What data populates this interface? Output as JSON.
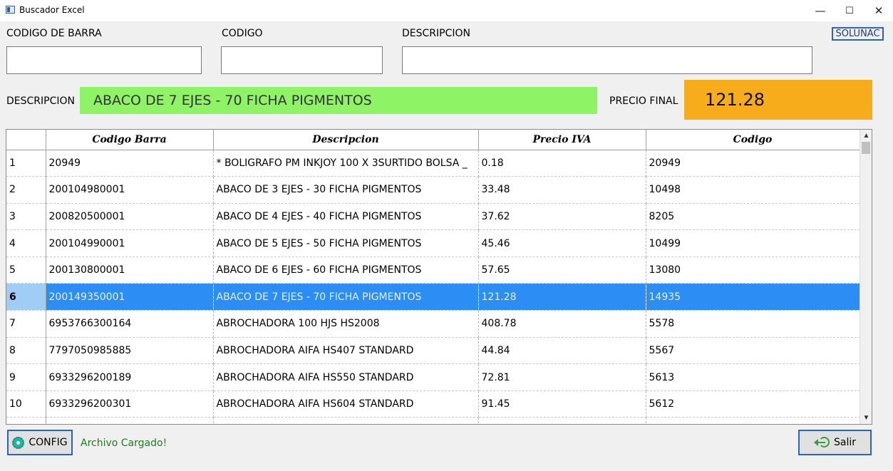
{
  "window": {
    "title": "Buscador Excel",
    "minimize": "—",
    "maximize": "☐",
    "close": "✕"
  },
  "search": {
    "barcode_label": "CODIGO DE BARRA",
    "code_label": "CODIGO",
    "description_label": "DESCRIPCION",
    "barcode_value": "",
    "code_value": "",
    "description_value": ""
  },
  "brand": "SOLUNAC",
  "result": {
    "description_label": "DESCRIPCION",
    "description_value": "ABACO DE 7 EJES - 70 FICHA PIGMENTOS",
    "price_label": "PRECIO FINAL",
    "price_value": "121.28",
    "description_color": "#8ef466",
    "price_color": "#f7ac1b"
  },
  "table": {
    "columns": [
      "",
      "Codigo Barra",
      "Descripcion",
      "Precio IVA",
      "Codigo"
    ],
    "selected_row": 6,
    "rows": [
      [
        "1",
        "20949",
        "* BOLIGRAFO PM INKJOY 100  X 3SURTIDO BOLSA _",
        "0.18",
        "20949"
      ],
      [
        "2",
        "200104980001",
        "ABACO DE 3 EJES - 30 FICHA PIGMENTOS",
        "33.48",
        "10498"
      ],
      [
        "3",
        "200820500001",
        "ABACO DE 4 EJES - 40 FICHA PIGMENTOS",
        "37.62",
        "8205"
      ],
      [
        "4",
        "200104990001",
        "ABACO DE 5 EJES - 50 FICHA PIGMENTOS",
        "45.46",
        "10499"
      ],
      [
        "5",
        "200130800001",
        "ABACO DE 6 EJES - 60 FICHA PIGMENTOS",
        "57.65",
        "13080"
      ],
      [
        "6",
        "200149350001",
        "ABACO DE 7 EJES - 70 FICHA PIGMENTOS",
        "121.28",
        "14935"
      ],
      [
        "7",
        "6953766300164",
        "ABROCHADORA 100 HJS HS2008",
        "408.78",
        "5578"
      ],
      [
        "8",
        "7797050985885",
        "ABROCHADORA AIFA HS407 STANDARD",
        "44.84",
        "5567"
      ],
      [
        "9",
        "6933296200189",
        "ABROCHADORA AIFA HS550 STANDARD",
        "72.81",
        "5613"
      ],
      [
        "10",
        "6933296200301",
        "ABROCHADORA AIFA HS604 STANDARD",
        "91.45",
        "5612"
      ],
      [
        "",
        "",
        "",
        "",
        ""
      ]
    ]
  },
  "footer": {
    "config_label": "CONFIG",
    "status_text": "Archivo Cargado!",
    "exit_label": "Salir"
  },
  "icons": {
    "app": "excel-window-icon",
    "config": "gear-icon",
    "exit": "exit-arrow-icon"
  }
}
